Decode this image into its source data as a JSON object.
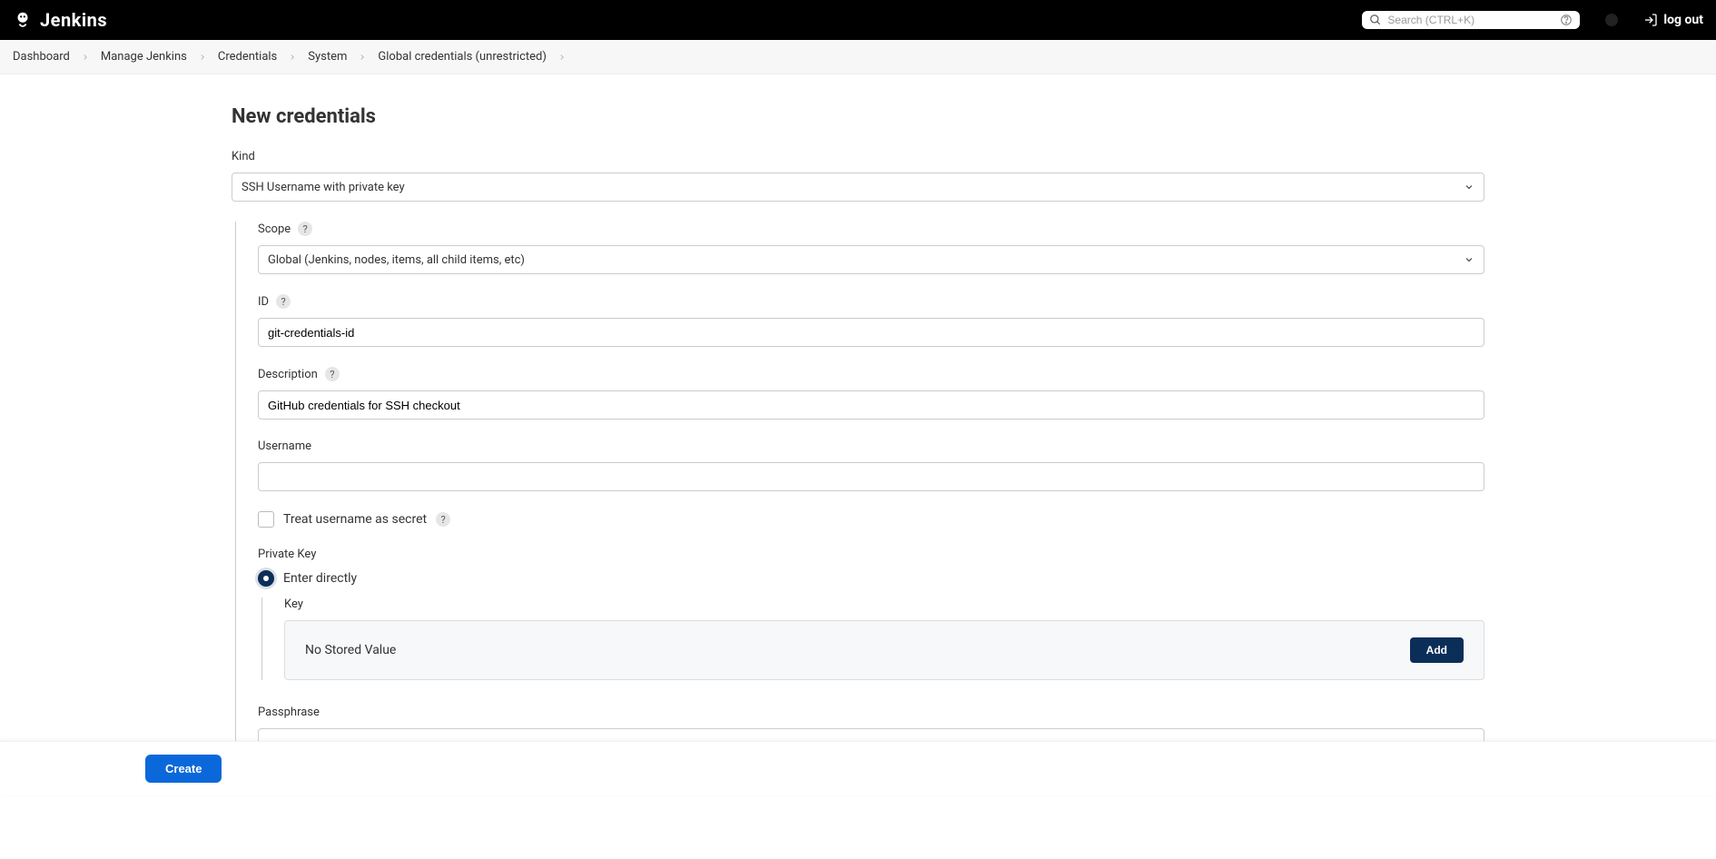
{
  "header": {
    "brand": "Jenkins",
    "search_placeholder": "Search (CTRL+K)",
    "logout_label": "log out"
  },
  "breadcrumbs": [
    {
      "label": "Dashboard"
    },
    {
      "label": "Manage Jenkins"
    },
    {
      "label": "Credentials"
    },
    {
      "label": "System"
    },
    {
      "label": "Global credentials (unrestricted)"
    }
  ],
  "page_title": "New credentials",
  "form": {
    "kind_label": "Kind",
    "kind_value": "SSH Username with private key",
    "scope_label": "Scope",
    "scope_value": "Global (Jenkins, nodes, items, all child items, etc)",
    "id_label": "ID",
    "id_value": "git-credentials-id",
    "description_label": "Description",
    "description_value": "GitHub credentials for SSH checkout",
    "username_label": "Username",
    "username_value": "",
    "treat_secret_label": "Treat username as secret",
    "private_key_label": "Private Key",
    "enter_directly_label": "Enter directly",
    "key_label": "Key",
    "no_stored_value": "No Stored Value",
    "add_label": "Add",
    "passphrase_label": "Passphrase",
    "passphrase_value": "",
    "create_label": "Create"
  }
}
